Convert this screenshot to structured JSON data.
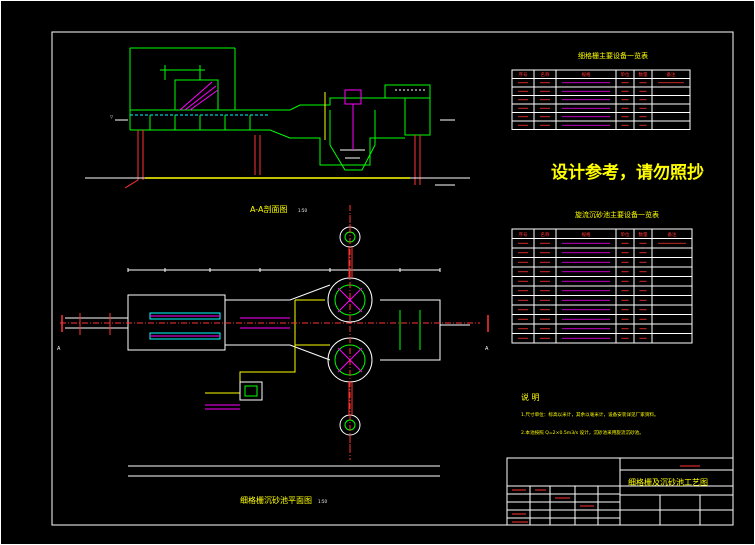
{
  "section_view": {
    "title": "A-A剖面图",
    "scale": "1:50"
  },
  "plan_view": {
    "title": "细格栅沉砂池平面图",
    "scale": "1:50"
  },
  "table1": {
    "title": "细格栅主要设备一览表",
    "headers": [
      "序号",
      "名称",
      "规格",
      "单位",
      "数量",
      "备注"
    ],
    "rows": 6
  },
  "table2": {
    "title": "旋流沉砂池主要设备一览表",
    "headers": [
      "序号",
      "名称",
      "规格",
      "单位",
      "数量",
      "备注"
    ],
    "rows": 11
  },
  "watermark": "设计参考，请勿照抄",
  "notes": {
    "title": "说 明",
    "lines": [
      "1.尺寸单位：标高以米计，其余以毫米计，设备安装详见厂家资料。",
      "2.本池按照 Q=2×0.5m3/s 设计，沉砂池采用旋流沉砂池。"
    ]
  },
  "title_block": {
    "drawing_title": "细格栅及沉砂池工艺图"
  },
  "colors": {
    "frame": "#ffffff",
    "structure": "#00ff00",
    "dimension": "#ff3333",
    "equipment": "#ff00ff",
    "pipe": "#ffff00",
    "hatch": "#00ffff",
    "accent": "#ffff00"
  }
}
